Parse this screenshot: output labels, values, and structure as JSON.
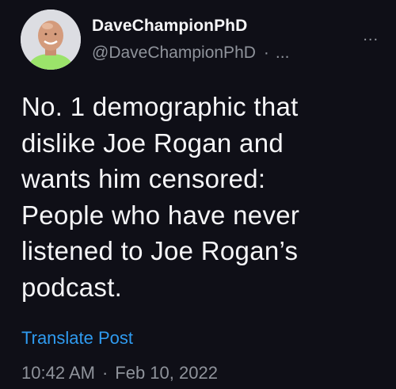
{
  "author": {
    "display_name": "DaveChampionPhD",
    "handle": "@DaveChampionPhD",
    "handle_separator": "·",
    "truncation": "...",
    "avatar_icon": "profile-photo-icon"
  },
  "more_menu": {
    "label": "...",
    "icon": "more-options-icon"
  },
  "post": {
    "text": "No. 1 demographic that\ndislike Joe Rogan and\nwants him censored:\nPeople who have never\nlistened to Joe Rogan’s\npodcast."
  },
  "translate": {
    "label": "Translate Post"
  },
  "meta": {
    "time": "10:42 AM",
    "separator": "·",
    "date": "Feb 10, 2022"
  },
  "colors": {
    "background": "#0f0f17",
    "primary_text": "#f5f5f7",
    "secondary_text": "#8f939b",
    "link": "#2f9bf0"
  }
}
